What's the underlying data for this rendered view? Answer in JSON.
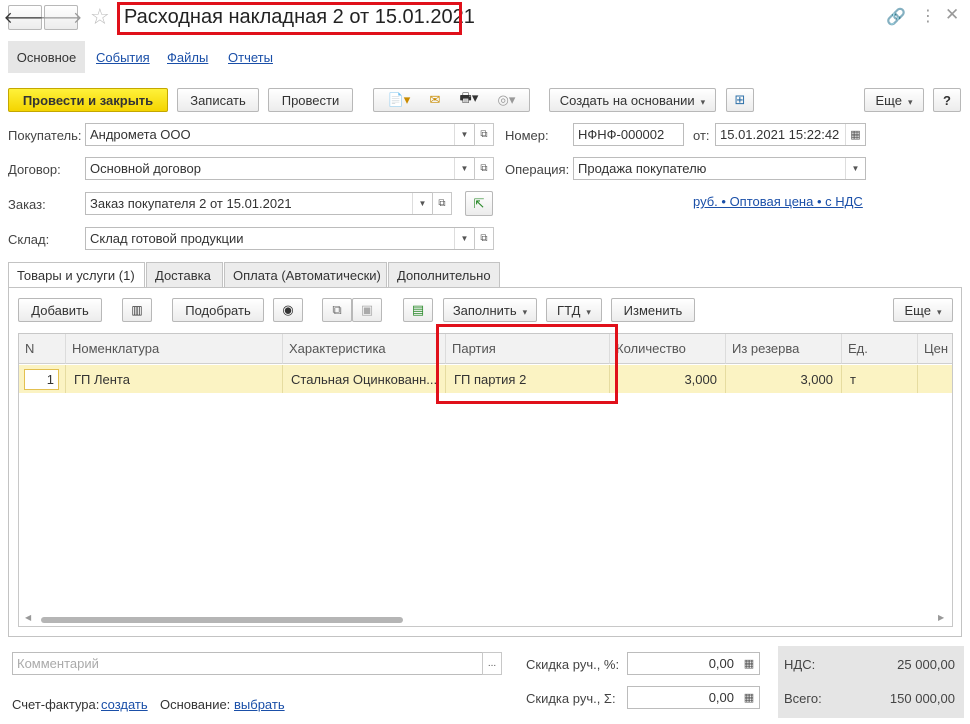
{
  "window": {
    "title": "Расходная накладная 2 от 15.01.2021"
  },
  "nav_tabs": [
    {
      "label": "Основное"
    },
    {
      "label": "События"
    },
    {
      "label": "Файлы"
    },
    {
      "label": "Отчеты"
    }
  ],
  "toolbar": {
    "post_close": "Провести и закрыть",
    "save": "Записать",
    "post": "Провести",
    "create_based": "Создать на основании",
    "more": "Еще",
    "help": "?"
  },
  "form": {
    "buyer_label": "Покупатель:",
    "buyer_value": "Андромета ООО",
    "contract_label": "Договор:",
    "contract_value": "Основной договор",
    "order_label": "Заказ:",
    "order_value": "Заказ покупателя 2 от 15.01.2021",
    "warehouse_label": "Склад:",
    "warehouse_value": "Склад готовой продукции",
    "number_label": "Номер:",
    "number_value": "НФНФ-000002",
    "date_label": "от:",
    "date_value": "15.01.2021 15:22:42",
    "operation_label": "Операция:",
    "operation_value": "Продажа покупателю",
    "price_link": "руб. • Оптовая цена • с НДС"
  },
  "section_tabs": [
    {
      "label": "Товары и услуги (1)"
    },
    {
      "label": "Доставка"
    },
    {
      "label": "Оплата (Автоматически)"
    },
    {
      "label": "Дополнительно"
    }
  ],
  "grid_toolbar": {
    "add": "Добавить",
    "pick": "Подобрать",
    "fill": "Заполнить",
    "gtd": "ГТД",
    "change": "Изменить",
    "more": "Еще"
  },
  "grid": {
    "columns": [
      "N",
      "Номенклатура",
      "Характеристика",
      "Партия",
      "Количество",
      "Из резерва",
      "Ед.",
      "Цен"
    ],
    "rows": [
      {
        "n": "1",
        "item": "ГП Лента",
        "characteristic": "Стальная Оцинкованн...",
        "batch": "ГП партия 2",
        "qty": "3,000",
        "reserve": "3,000",
        "unit": "т"
      }
    ]
  },
  "footer": {
    "comment_placeholder": "Комментарий",
    "discount_pct_label": "Скидка руч., %:",
    "discount_pct_value": "0,00",
    "discount_sum_label": "Скидка руч., Σ:",
    "discount_sum_value": "0,00",
    "vat_label": "НДС:",
    "vat_value": "25 000,00",
    "total_label": "Всего:",
    "total_value": "150 000,00",
    "invoice_label": "Счет-фактура:",
    "invoice_link": "создать",
    "basis_label": "Основание:",
    "basis_link": "выбрать"
  }
}
